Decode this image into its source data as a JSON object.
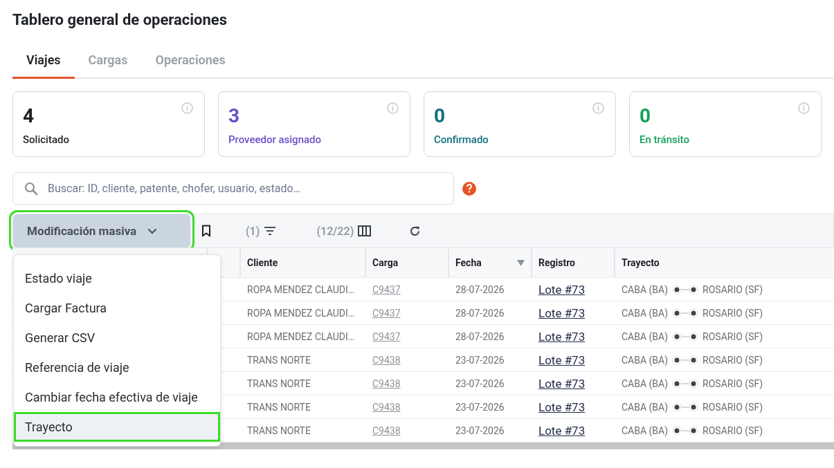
{
  "title": "Tablero general de operaciones",
  "tabs": [
    {
      "label": "Viajes",
      "selected": true
    },
    {
      "label": "Cargas",
      "selected": false
    },
    {
      "label": "Operaciones",
      "selected": false
    }
  ],
  "cards": [
    {
      "count": "4",
      "label": "Solicitado",
      "color": "#1f2226"
    },
    {
      "count": "3",
      "label": "Proveedor asignado",
      "color": "#6a4fc8"
    },
    {
      "count": "0",
      "label": "Confirmado",
      "color": "#0f6f80"
    },
    {
      "count": "0",
      "label": "En tránsito",
      "color": "#14a05a"
    }
  ],
  "search": {
    "placeholder": "Buscar: ID, cliente, patente, chofer, usuario, estado…"
  },
  "toolbar": {
    "bulk_button": "Modificación masiva",
    "filter_count": "(1)",
    "columns_count": "(12/22)"
  },
  "menu": [
    {
      "label": "Estado viaje",
      "selected": false
    },
    {
      "label": "Cargar Factura",
      "selected": false
    },
    {
      "label": "Generar CSV",
      "selected": false
    },
    {
      "label": "Referencia de viaje",
      "selected": false
    },
    {
      "label": "Cambiar fecha efectiva de viaje",
      "selected": false
    },
    {
      "label": "Trayecto",
      "selected": true
    }
  ],
  "table": {
    "columns": [
      "Cliente",
      "Carga",
      "Fecha",
      "Registro",
      "Trayecto"
    ],
    "rows": [
      {
        "cliente": "ROPA MENDEZ CLAUDI…",
        "carga": "C9437",
        "fecha": "28-07-2026",
        "registro": "Lote #73",
        "origen": "CABA (BA)",
        "destino": "ROSARIO (SF)"
      },
      {
        "cliente": "ROPA MENDEZ CLAUDI…",
        "carga": "C9437",
        "fecha": "28-07-2026",
        "registro": "Lote #73",
        "origen": "CABA (BA)",
        "destino": "ROSARIO (SF)"
      },
      {
        "cliente": "ROPA MENDEZ CLAUDI…",
        "carga": "C9437",
        "fecha": "28-07-2026",
        "registro": "Lote #73",
        "origen": "CABA (BA)",
        "destino": "ROSARIO (SF)"
      },
      {
        "cliente": "TRANS NORTE",
        "carga": "C9438",
        "fecha": "23-07-2026",
        "registro": "Lote #73",
        "origen": "CABA (BA)",
        "destino": "ROSARIO (SF)"
      },
      {
        "cliente": "TRANS NORTE",
        "carga": "C9438",
        "fecha": "23-07-2026",
        "registro": "Lote #73",
        "origen": "CABA (BA)",
        "destino": "ROSARIO (SF)"
      },
      {
        "cliente": "TRANS NORTE",
        "carga": "C9438",
        "fecha": "23-07-2026",
        "registro": "Lote #73",
        "origen": "CABA (BA)",
        "destino": "ROSARIO (SF)"
      },
      {
        "cliente": "TRANS NORTE",
        "carga": "C9438",
        "fecha": "23-07-2026",
        "registro": "Lote #73",
        "origen": "CABA (BA)",
        "destino": "ROSARIO (SF)"
      }
    ]
  }
}
